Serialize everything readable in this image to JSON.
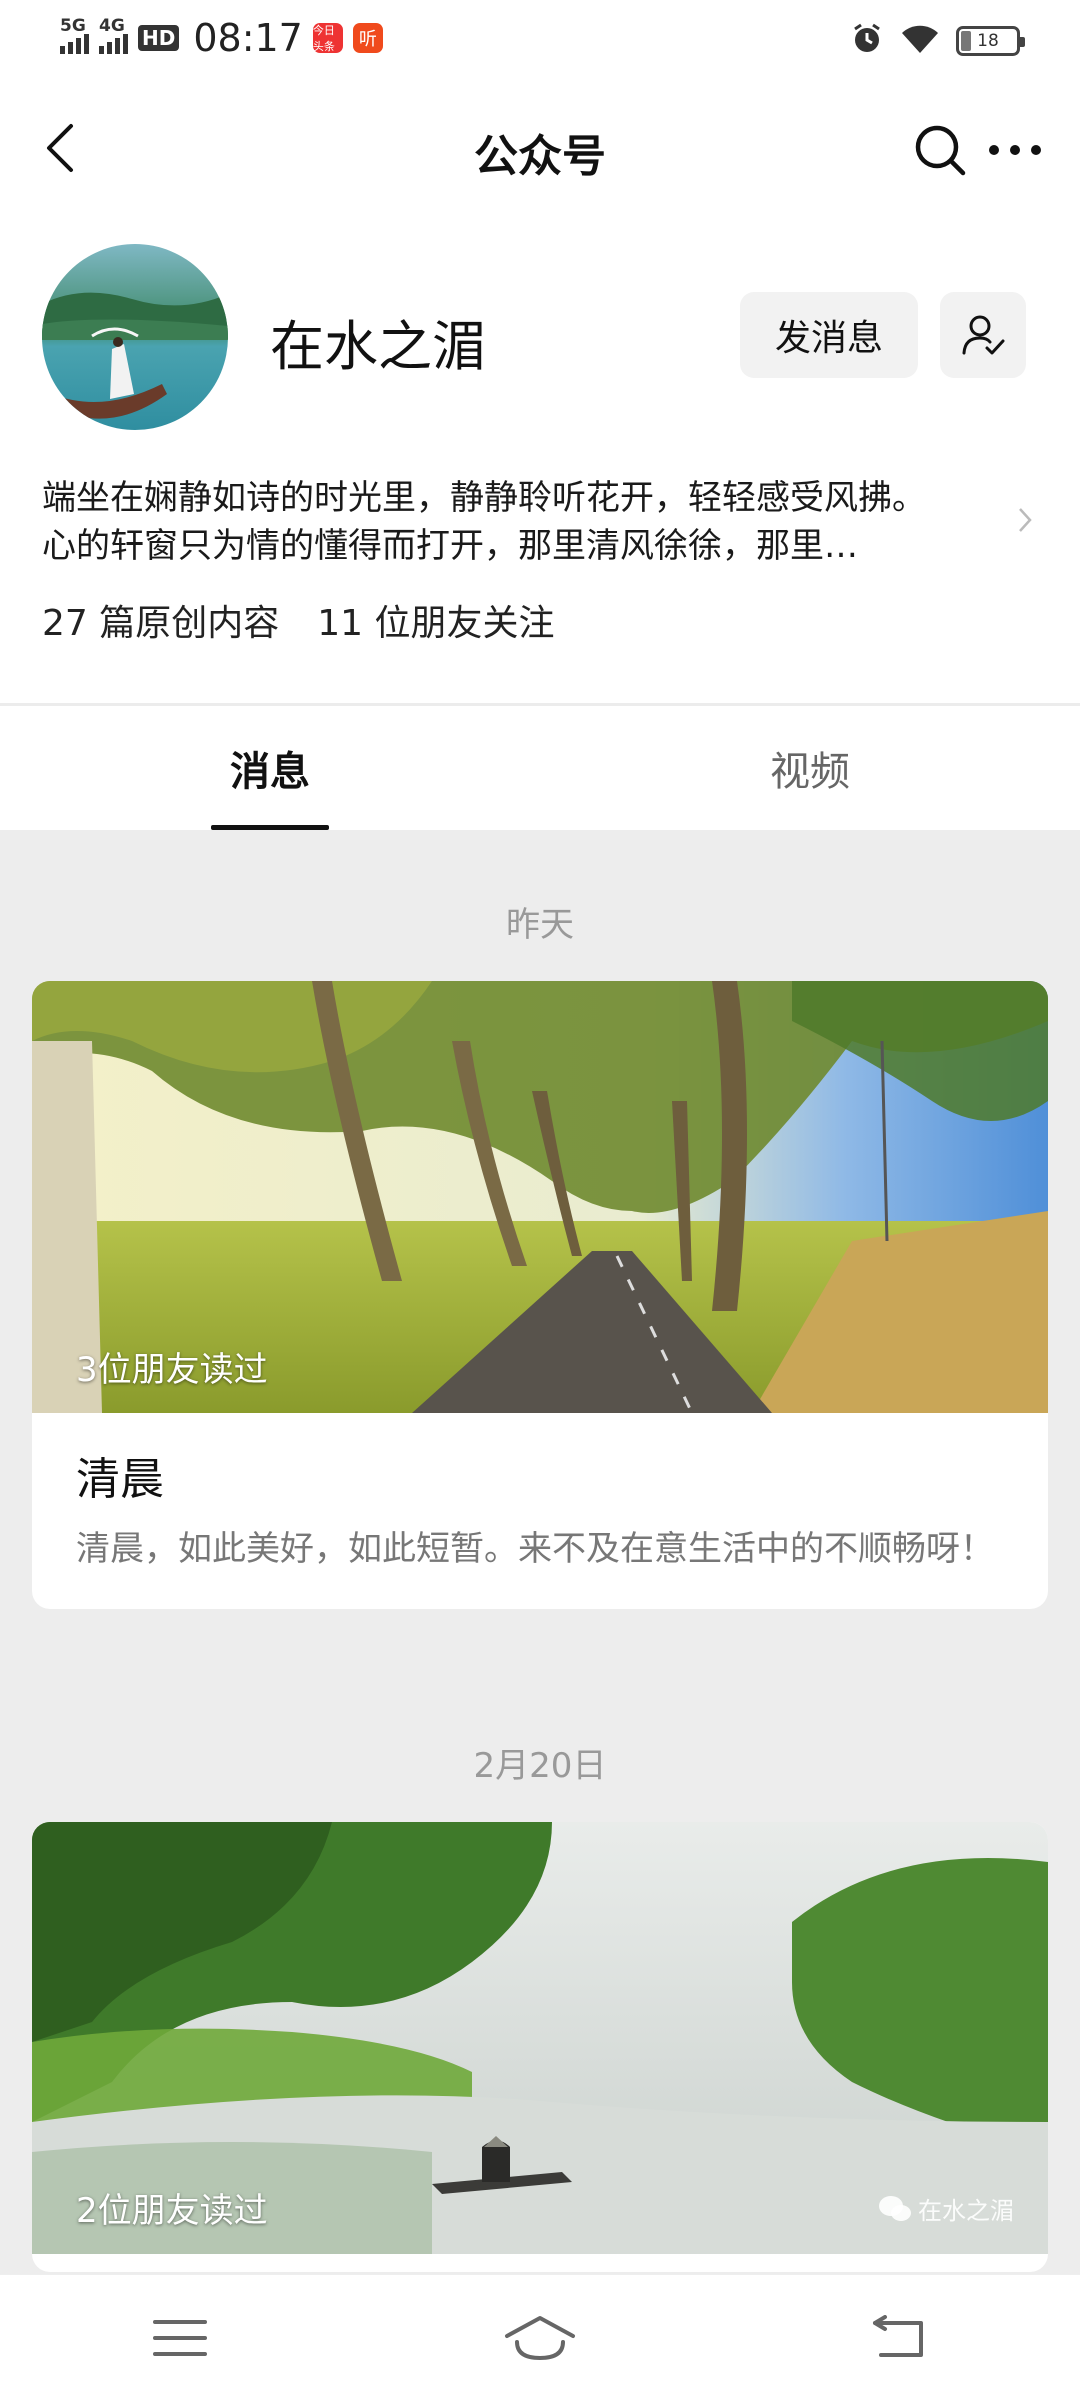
{
  "status_bar": {
    "network_1": "5G",
    "network_2": "4G",
    "hd_label": "HD",
    "time": "08:17",
    "app_badge_1": "今日头条",
    "app_badge_2": "听",
    "battery": "18"
  },
  "nav": {
    "title": "公众号",
    "back_icon": "chevron-left-icon",
    "search_icon": "search-icon",
    "more_icon": "more-dots-icon"
  },
  "profile": {
    "account_name": "在水之湄",
    "message_button": "发消息",
    "follow_icon": "user-check-icon"
  },
  "description": {
    "line1": "端坐在娴静如诗的时光里，静静聆听花开，轻轻感受风拂。",
    "line2": "心的轩窗只为情的懂得而打开，那里清风徐徐，那里…"
  },
  "stats": {
    "original": "27 篇原创内容",
    "followers": "11 位朋友关注"
  },
  "tabs": [
    {
      "label": "消息",
      "active": true
    },
    {
      "label": "视频",
      "active": false
    }
  ],
  "feed": [
    {
      "date": "昨天",
      "readers": "3位朋友读过",
      "title": "清晨",
      "summary": "清晨，如此美好，如此短暂。来不及在意生活中的不顺畅呀！"
    },
    {
      "date": "2月20日",
      "readers": "2位朋友读过",
      "watermark": "在水之湄"
    }
  ],
  "system_nav": {
    "menu_icon": "menu-icon",
    "home_icon": "home-icon",
    "back_icon": "back-arrow-icon"
  }
}
